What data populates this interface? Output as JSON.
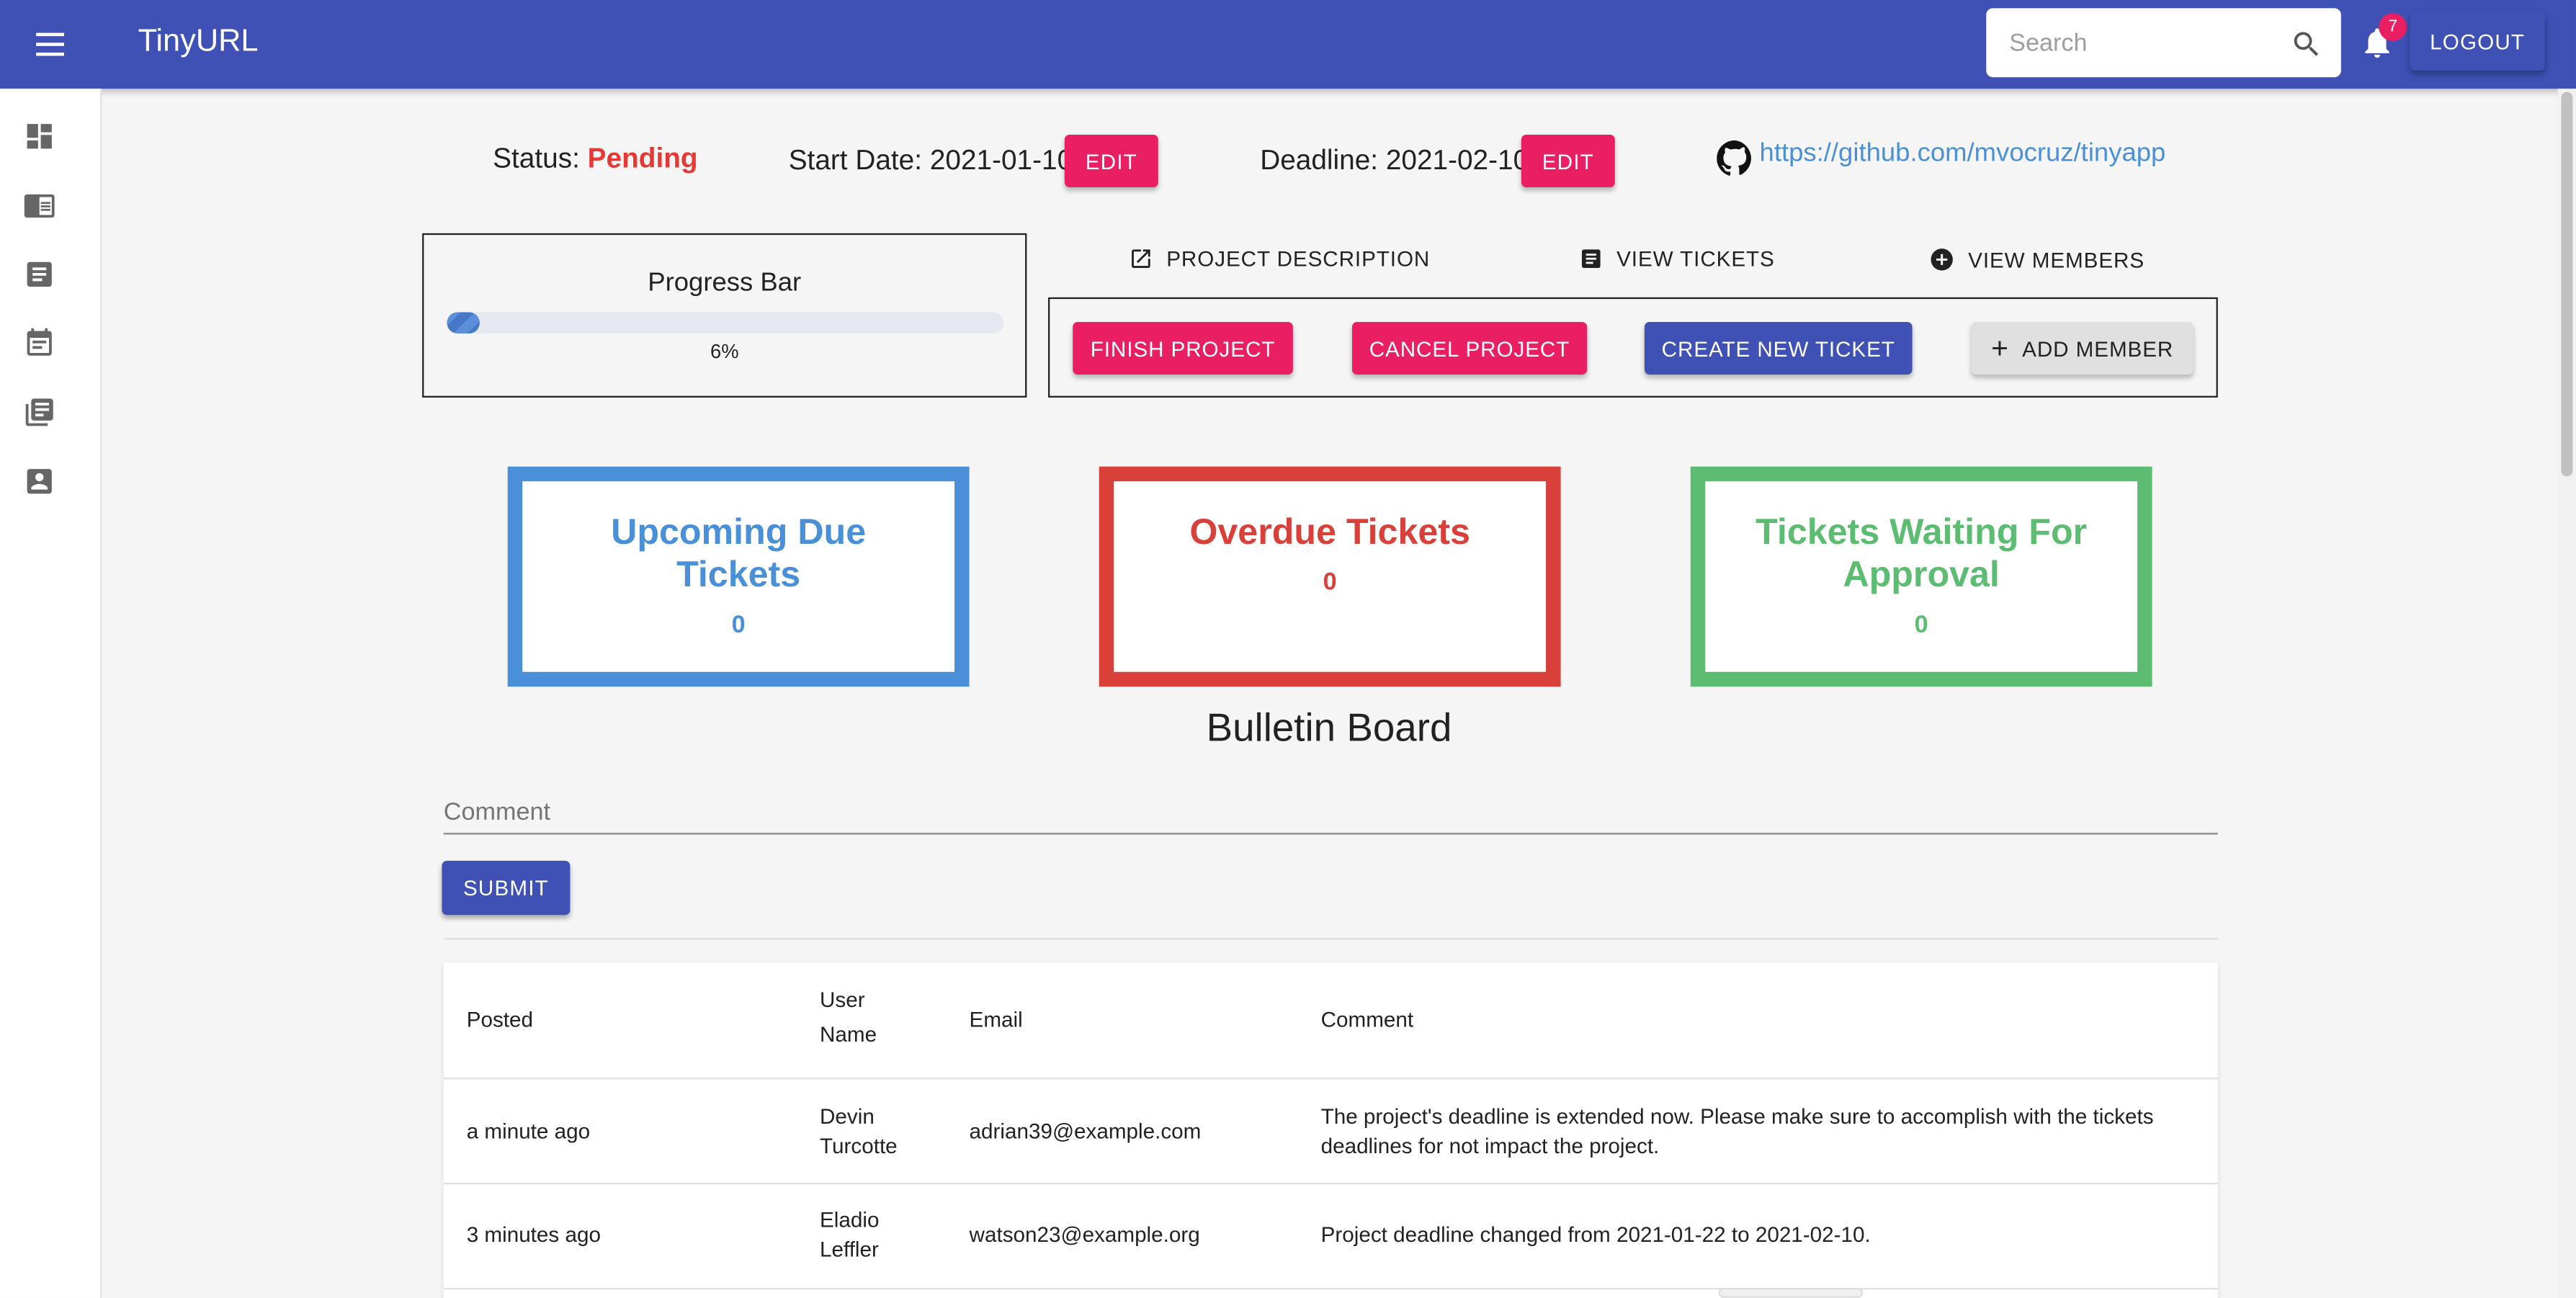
{
  "app": {
    "title": "TinyURL"
  },
  "topbar": {
    "search_placeholder": "Search",
    "notification_count": "7",
    "logout_label": "LOGOUT"
  },
  "sidebar": {
    "items": [
      {
        "icon": "dashboard-icon"
      },
      {
        "icon": "chrome-reader-mode-icon"
      },
      {
        "icon": "list-alt-icon"
      },
      {
        "icon": "event-note-icon"
      },
      {
        "icon": "library-books-icon"
      },
      {
        "icon": "account-box-icon"
      }
    ]
  },
  "project": {
    "status_label": "Status:",
    "status_value": "Pending",
    "start_label": "Start Date:",
    "start_value": "2021-01-10",
    "deadline_label": "Deadline:",
    "deadline_value": "2021-02-10",
    "edit_label": "EDIT",
    "repo_url": "https://github.com/mvocruz/tinyapp"
  },
  "progress": {
    "title": "Progress Bar",
    "percent_text": "6%",
    "percent": 6
  },
  "tabs": {
    "description": "PROJECT DESCRIPTION",
    "tickets": "VIEW TICKETS",
    "members": "VIEW MEMBERS"
  },
  "actions": {
    "finish": "FINISH PROJECT",
    "cancel": "CANCEL PROJECT",
    "create": "CREATE NEW TICKET",
    "add_member": "ADD MEMBER"
  },
  "cards": [
    {
      "title": "Upcoming Due Tickets",
      "count": "0",
      "color": "#4a90d9"
    },
    {
      "title": "Overdue Tickets",
      "count": "0",
      "color": "#d9403a"
    },
    {
      "title": "Tickets Waiting For Approval",
      "count": "0",
      "color": "#5cbd72"
    }
  ],
  "bulletin": {
    "title": "Bulletin Board",
    "comment_placeholder": "Comment",
    "submit_label": "SUBMIT",
    "columns": {
      "posted": "Posted",
      "user_name": "User Name",
      "email": "Email",
      "comment": "Comment"
    },
    "rows": [
      {
        "posted": "a minute ago",
        "user": "Devin Turcotte",
        "email": "adrian39@example.com",
        "comment": "The project's deadline is extended now. Please make sure to accomplish with the tickets deadlines for not impact the project."
      },
      {
        "posted": "3 minutes ago",
        "user": "Eladio Leffler",
        "email": "watson23@example.org",
        "comment": "Project deadline changed from 2021-01-22 to 2021-02-10."
      }
    ]
  },
  "colors": {
    "primary": "#3f51b5",
    "secondary": "#e91e63",
    "status_pending": "#e53935",
    "link": "#4a90d9"
  }
}
